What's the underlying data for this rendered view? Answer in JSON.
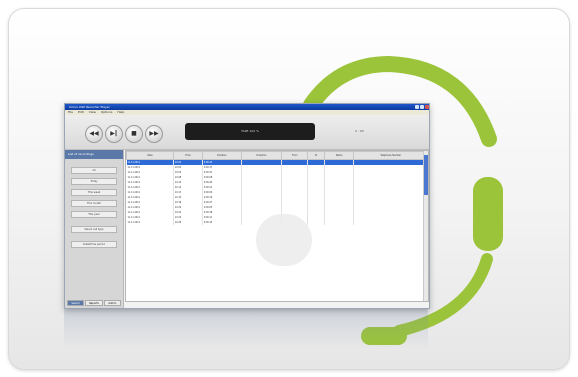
{
  "app": {
    "window_title": "Cirrus VoIP Recorder Player",
    "menu": [
      "File",
      "Edit",
      "View",
      "Options",
      "Help"
    ],
    "toolbar": {
      "rewind_icon": "rewind-icon",
      "play_icon": "play-pause-icon",
      "stop_icon": "stop-icon",
      "forward_icon": "forward-icon",
      "display_text": "TAPE 100 %",
      "timecode": "0 : 00"
    },
    "sidebar": {
      "title": "List of recordings",
      "buttons": [
        "All",
        "Today",
        "This week",
        "This month",
        "This year",
        "Select call type",
        "Date/Time period"
      ],
      "tabs": [
        "Search",
        "Reports",
        "Admin"
      ]
    },
    "grid": {
      "columns": [
        "Date",
        "Time",
        "Duration",
        "Direction",
        "From",
        "To",
        "Name",
        "Telephone Number"
      ],
      "rows": [
        [
          "11.11.2011",
          "10:02",
          "0:00:12",
          "",
          "",
          "",
          "",
          ""
        ],
        [
          "11.11.2011",
          "10:03",
          "0:00:17",
          "",
          "",
          "",
          "",
          ""
        ],
        [
          "11.11.2011",
          "10:05",
          "0:00:31",
          "",
          "",
          "",
          "",
          ""
        ],
        [
          "11.11.2011",
          "10:08",
          "0:00:08",
          "",
          "",
          "",
          "",
          ""
        ],
        [
          "11.11.2011",
          "10:10",
          "0:00:44",
          "",
          "",
          "",
          "",
          ""
        ],
        [
          "11.11.2011",
          "10:12",
          "0:00:21",
          "",
          "",
          "",
          "",
          ""
        ],
        [
          "11.11.2011",
          "10:13",
          "0:00:09",
          "",
          "",
          "",
          "",
          ""
        ],
        [
          "11.11.2011",
          "10:15",
          "0:00:16",
          "",
          "",
          "",
          "",
          ""
        ],
        [
          "11.11.2011",
          "10:18",
          "0:00:27",
          "",
          "",
          "",
          "",
          ""
        ],
        [
          "11.11.2011",
          "10:20",
          "0:00:05",
          "",
          "",
          "",
          "",
          ""
        ],
        [
          "11.11.2011",
          "10:22",
          "0:00:38",
          "",
          "",
          "",
          "",
          ""
        ],
        [
          "11.11.2011",
          "10:24",
          "0:00:11",
          "",
          "",
          "",
          "",
          ""
        ],
        [
          "11.11.2011",
          "10:26",
          "0:00:19",
          "",
          "",
          "",
          "",
          ""
        ]
      ]
    }
  },
  "colors": {
    "headset": "#9bc43a",
    "titlebar": "#1f57c9",
    "selection": "#2d6ad6"
  }
}
